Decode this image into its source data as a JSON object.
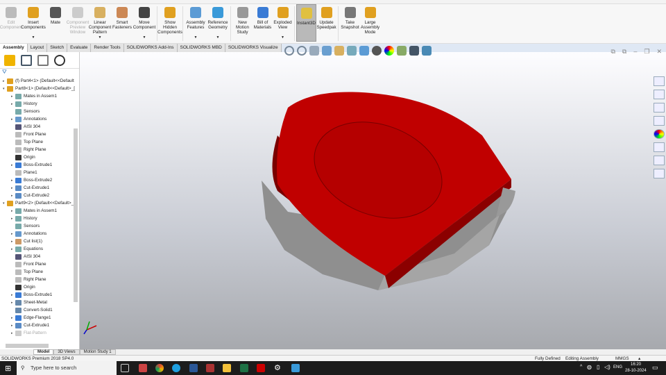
{
  "ribbon": [
    {
      "label": "Edit Component",
      "disabled": true
    },
    {
      "label": "Insert Components",
      "dropdown": true
    },
    {
      "label": "Mate"
    },
    {
      "label": "Component Preview Window",
      "disabled": true
    },
    {
      "label": "Linear Component Pattern",
      "dropdown": true
    },
    {
      "label": "Smart Fasteners"
    },
    {
      "label": "Move Component",
      "dropdown": true
    },
    {
      "label": "Show Hidden Components"
    },
    {
      "label": "Assembly Features",
      "dropdown": true
    },
    {
      "label": "Reference Geometry",
      "dropdown": true
    },
    {
      "label": "New Motion Study"
    },
    {
      "label": "Bill of Materials"
    },
    {
      "label": "Exploded View",
      "dropdown": true
    },
    {
      "label": "Instant3D",
      "active": true
    },
    {
      "label": "Update Speedpak"
    },
    {
      "label": "Take Snapshot"
    },
    {
      "label": "Large Assembly Mode"
    }
  ],
  "tabs": [
    "Assembly",
    "Layout",
    "Sketch",
    "Evaluate",
    "Render Tools",
    "SOLIDWORKS Add-Ins",
    "SOLIDWORKS MBD",
    "SOLIDWORKS Visualize"
  ],
  "tree": [
    {
      "label": "(f) Part4<1> (Default<<Default",
      "lvl": 0,
      "ex": "▸",
      "c": "#e0a020"
    },
    {
      "label": "Part8<1> (Default<<Default>_[",
      "lvl": 0,
      "ex": "▾",
      "c": "#e0a020"
    },
    {
      "label": "Mates in Assem1",
      "lvl": 1,
      "ex": "▸",
      "c": "#7aa"
    },
    {
      "label": "History",
      "lvl": 1,
      "ex": "▸",
      "c": "#7aa"
    },
    {
      "label": "Sensors",
      "lvl": 1,
      "ex": "",
      "c": "#7aa"
    },
    {
      "label": "Annotations",
      "lvl": 1,
      "ex": "▸",
      "c": "#69c"
    },
    {
      "label": "AISI 304",
      "lvl": 1,
      "ex": "",
      "c": "#557"
    },
    {
      "label": "Front Plane",
      "lvl": 1,
      "ex": "",
      "c": "#bbb"
    },
    {
      "label": "Top Plane",
      "lvl": 1,
      "ex": "",
      "c": "#bbb"
    },
    {
      "label": "Right Plane",
      "lvl": 1,
      "ex": "",
      "c": "#bbb"
    },
    {
      "label": "Origin",
      "lvl": 1,
      "ex": "",
      "c": "#333"
    },
    {
      "label": "Boss-Extrude1",
      "lvl": 1,
      "ex": "▸",
      "c": "#3a7bd5"
    },
    {
      "label": "Plane1",
      "lvl": 1,
      "ex": "",
      "c": "#bbb"
    },
    {
      "label": "Boss-Extrude2",
      "lvl": 1,
      "ex": "▸",
      "c": "#3a7bd5"
    },
    {
      "label": "Cut-Extrude1",
      "lvl": 1,
      "ex": "▸",
      "c": "#5a8bc5"
    },
    {
      "label": "Cut-Extrude2",
      "lvl": 1,
      "ex": "▸",
      "c": "#5a8bc5"
    },
    {
      "label": "Part9<2> (Default<<Default>_[",
      "lvl": 0,
      "ex": "▾",
      "c": "#e0a020"
    },
    {
      "label": "Mates in Assem1",
      "lvl": 1,
      "ex": "▸",
      "c": "#7aa"
    },
    {
      "label": "History",
      "lvl": 1,
      "ex": "▸",
      "c": "#7aa"
    },
    {
      "label": "Sensors",
      "lvl": 1,
      "ex": "",
      "c": "#7aa"
    },
    {
      "label": "Annotations",
      "lvl": 1,
      "ex": "▸",
      "c": "#69c"
    },
    {
      "label": "Cut list(1)",
      "lvl": 1,
      "ex": "▸",
      "c": "#c96"
    },
    {
      "label": "Equations",
      "lvl": 1,
      "ex": "▸",
      "c": "#7aa"
    },
    {
      "label": "AISI 304",
      "lvl": 1,
      "ex": "",
      "c": "#557"
    },
    {
      "label": "Front Plane",
      "lvl": 1,
      "ex": "",
      "c": "#bbb"
    },
    {
      "label": "Top Plane",
      "lvl": 1,
      "ex": "",
      "c": "#bbb"
    },
    {
      "label": "Right Plane",
      "lvl": 1,
      "ex": "",
      "c": "#bbb"
    },
    {
      "label": "Origin",
      "lvl": 1,
      "ex": "",
      "c": "#333"
    },
    {
      "label": "Boss-Extrude1",
      "lvl": 1,
      "ex": "▸",
      "c": "#3a7bd5"
    },
    {
      "label": "Sheet-Metal",
      "lvl": 1,
      "ex": "▸",
      "c": "#68a"
    },
    {
      "label": "Convert-Solid1",
      "lvl": 1,
      "ex": "",
      "c": "#68a"
    },
    {
      "label": "Edge-Flange1",
      "lvl": 1,
      "ex": "▸",
      "c": "#3a7bd5"
    },
    {
      "label": "Cut-Extrude1",
      "lvl": 1,
      "ex": "▸",
      "c": "#5a8bc5"
    },
    {
      "label": "Flat-Pattern",
      "lvl": 1,
      "ex": "▸",
      "c": "#ccc",
      "grey": true
    }
  ],
  "bottom_tabs": [
    "Model",
    "3D Views",
    "Motion Study 1"
  ],
  "status": {
    "app": "SOLIDWORKS Premium 2018 SP4.0",
    "defined": "Fully Defined",
    "mode": "Editing Assembly",
    "units": "MMGS",
    "units_arrow": "▴"
  },
  "taskbar": {
    "search_placeholder": "Type here to search",
    "lang": "ENG",
    "time": "16:20",
    "date": "28-10-2024"
  },
  "colors": {
    "model_red": "#c00000",
    "model_grey": "#8a8a8a"
  }
}
